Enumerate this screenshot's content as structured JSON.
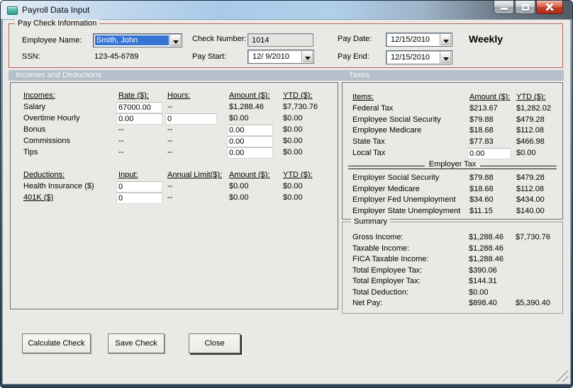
{
  "window": {
    "title": "Payroll Data Input"
  },
  "paycheck": {
    "legend": "Pay Check Information",
    "employee_name_label": "Employee Name:",
    "employee_name_value": "Smith, John",
    "ssn_label": "SSN:",
    "ssn_value": "123-45-6789",
    "check_number_label": "Check Number:",
    "check_number_value": "1014",
    "pay_start_label": "Pay Start:",
    "pay_start_value": "12/ 9/2010",
    "pay_date_label": "Pay Date:",
    "pay_date_value": "12/15/2010",
    "pay_end_label": "Pay End:",
    "pay_end_value": "12/15/2010",
    "frequency": "Weekly"
  },
  "sections": {
    "incomes_and_deductions": "Incomes and Deductions",
    "taxes": "Taxes"
  },
  "incomes": {
    "headers": {
      "c1": "Incomes:",
      "c2": "Rate ($):",
      "c3": "Hours:",
      "c4": "Amount ($):",
      "c5": "YTD ($):"
    },
    "rows": [
      {
        "label": "Salary",
        "rate": "67000.00",
        "hours": "--",
        "amount": "$1,288.46",
        "ytd": "$7,730.76"
      },
      {
        "label": "Overtime Hourly",
        "rate": "0.00",
        "hours": "0",
        "amount": "$0.00",
        "ytd": "$0.00"
      },
      {
        "label": "Bonus",
        "rate": "--",
        "hours": "--",
        "amount": "0.00",
        "ytd": "$0.00"
      },
      {
        "label": "Commissions",
        "rate": "--",
        "hours": "--",
        "amount": "0.00",
        "ytd": "$0.00"
      },
      {
        "label": "Tips",
        "rate": "--",
        "hours": "--",
        "amount": "0.00",
        "ytd": "$0.00"
      }
    ]
  },
  "deductions": {
    "headers": {
      "c1": "Deductions:",
      "c2": "Input:",
      "c3": "Annual Limit($):",
      "c4": "Amount ($):",
      "c5": "YTD ($):"
    },
    "rows": [
      {
        "label": "Health Insurance ($)",
        "input": "0",
        "limit": "--",
        "amount": "$0.00",
        "ytd": "$0.00"
      },
      {
        "label": "401K ($)",
        "input": "0",
        "limit": "--",
        "amount": "$0.00",
        "ytd": "$0.00"
      }
    ]
  },
  "taxes": {
    "headers": {
      "c1": "Items:",
      "c2": "Amount ($):",
      "c3": "YTD ($):"
    },
    "employee_rows": [
      {
        "label": "Federal Tax",
        "amount": "$213.67",
        "ytd": "$1,282.02"
      },
      {
        "label": "Employee Social Security",
        "amount": "$79.88",
        "ytd": "$479.28"
      },
      {
        "label": "Employee Medicare",
        "amount": "$18.68",
        "ytd": "$112.08"
      },
      {
        "label": "State Tax",
        "amount": "$77.83",
        "ytd": "$466.98"
      }
    ],
    "local_tax": {
      "label": "Local Tax",
      "amount_input": "0.00",
      "ytd": "$0.00"
    },
    "divider_label": "Employer Tax",
    "employer_rows": [
      {
        "label": "Employer Social Security",
        "amount": "$79.88",
        "ytd": "$479.28"
      },
      {
        "label": "Employer Medicare",
        "amount": "$18.68",
        "ytd": "$112.08"
      },
      {
        "label": "Employer Fed Unemployment",
        "amount": "$34.60",
        "ytd": "$434.00"
      },
      {
        "label": "Employer State Unemployment",
        "amount": "$11.15",
        "ytd": "$140.00"
      }
    ]
  },
  "summary": {
    "legend": "Summary",
    "rows": [
      {
        "label": "Gross Income:",
        "amount": "$1,288.46",
        "ytd": "$7,730.76"
      },
      {
        "label": "Taxable Income:",
        "amount": "$1,288.46",
        "ytd": ""
      },
      {
        "label": "FICA Taxable Income:",
        "amount": "$1,288.46",
        "ytd": ""
      },
      {
        "label": "Total Employee Tax:",
        "amount": "$390.06",
        "ytd": ""
      },
      {
        "label": "Total Employer Tax:",
        "amount": "$144.31",
        "ytd": ""
      },
      {
        "label": "Total Deduction:",
        "amount": "$0.00",
        "ytd": ""
      },
      {
        "label": "Net Pay:",
        "amount": "$898.40",
        "ytd": "$5,390.40"
      }
    ]
  },
  "buttons": {
    "calculate": "Calculate Check",
    "save": "Save Check",
    "close": "Close"
  },
  "colors": {
    "group_border_red": "#c0605a",
    "section_bar": "#b4bfca",
    "selection_blue": "#3674d3",
    "client_bg": "#e9e9e6"
  }
}
